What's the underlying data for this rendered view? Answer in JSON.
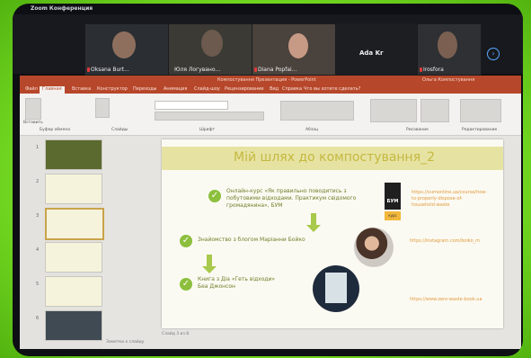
{
  "zoom": {
    "title": "Zoom Конференция",
    "participants": [
      {
        "name": "Oksana Burt..."
      },
      {
        "name": "Юля Логувано..."
      },
      {
        "name": "Diana Popfai..."
      },
      {
        "name": "Ada Kr"
      },
      {
        "name": "Irosfora"
      }
    ]
  },
  "ppt": {
    "window_title": "Компостування Презентация - PowerPoint",
    "user": "Ольга Компостування",
    "tabs": [
      "Файл",
      "Главная",
      "Вставка",
      "Конструктор",
      "Переходы",
      "Анимация",
      "Слайд-шоу",
      "Рецензирование",
      "Вид",
      "Справка",
      "Что вы хотите сделать?"
    ],
    "ribbon": {
      "paste": "Вставить",
      "clipboard_group": "Буфер обмена",
      "slides_group": "Слайды",
      "font_group": "Шрифт",
      "paragraph_group": "Абзац",
      "drawing_group": "Рисование",
      "editing_group": "Редактирование"
    },
    "thumbnail_numbers": [
      "1",
      "2",
      "3",
      "4",
      "5",
      "6"
    ],
    "footer": "Слайд 3 из 8",
    "notes": "Заметки к слайду"
  },
  "slide": {
    "title": "Мій шлях до компостування_2",
    "items": [
      "Онлайн-курс «Як правильно поводитись з побутовими відходами. Практикум свідомого громадянина», БУМ",
      "Знайомство з блогом Маріанни Бойко",
      "Книга з Діа «Геть відходи»\nБеа Джонсон"
    ],
    "bum_label": "БУМ",
    "bum_tag": "курс",
    "links": [
      "https://vumonline.ua/course/how-to-properly-dispose-of-household-waste",
      "https://instagram.com/boiko_m",
      "https://www.zero-waste-book.ua"
    ]
  }
}
